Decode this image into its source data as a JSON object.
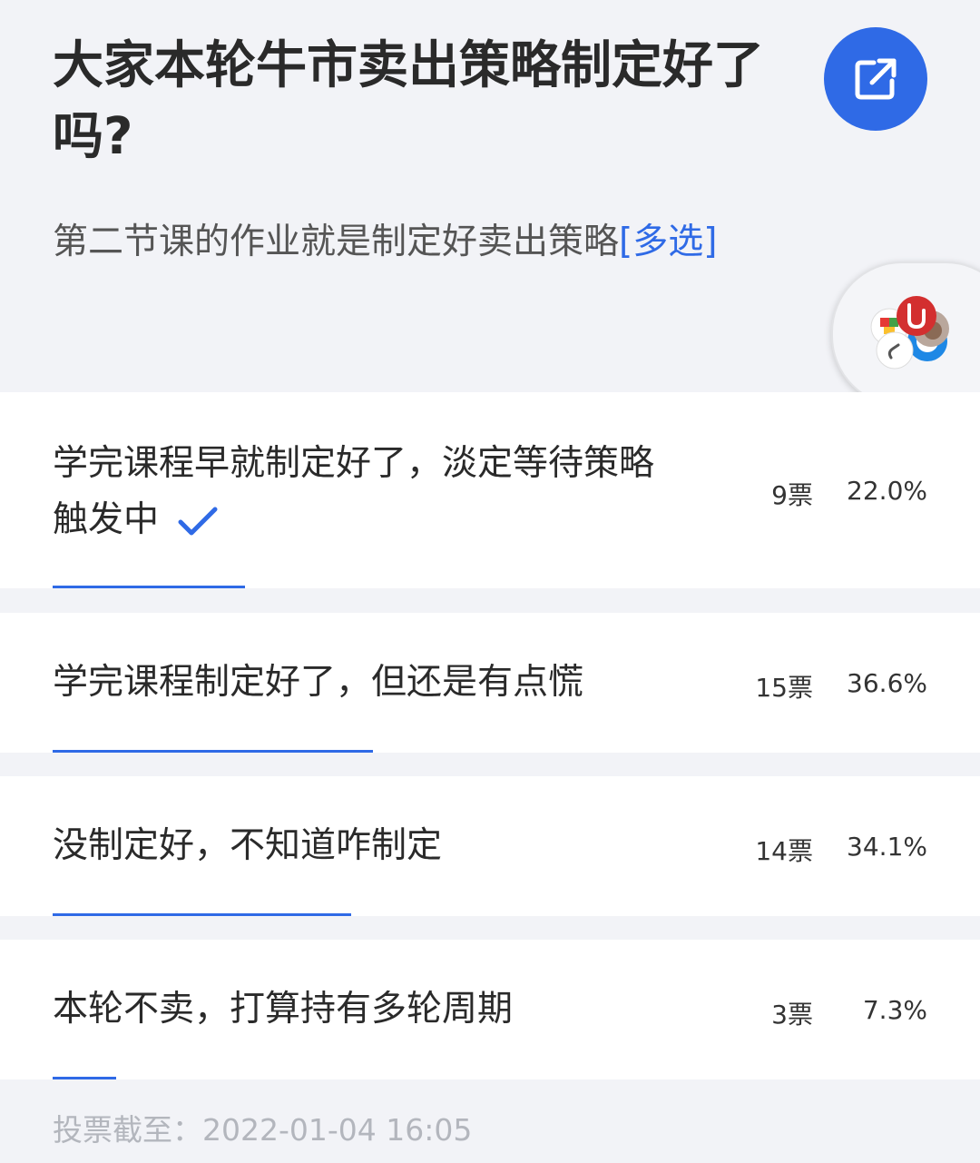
{
  "poll": {
    "title": "大家本轮牛市卖出策略制定好了吗?",
    "subtitle": "第二节课的作业就是制定好卖出策略",
    "multi_tag": "[多选]",
    "options": [
      {
        "label": "学完课程早就制定好了，淡定等待策略触发中",
        "votes": "9票",
        "percent": "22.0%",
        "percent_value": 22.0,
        "selected": true
      },
      {
        "label": "学完课程制定好了，但还是有点慌",
        "votes": "15票",
        "percent": "36.6%",
        "percent_value": 36.6,
        "selected": false
      },
      {
        "label": "没制定好，不知道咋制定",
        "votes": "14票",
        "percent": "34.1%",
        "percent_value": 34.1,
        "selected": false
      },
      {
        "label": "本轮不卖，打算持有多轮周期",
        "votes": "3票",
        "percent": "7.3%",
        "percent_value": 7.3,
        "selected": false
      }
    ],
    "deadline": "投票截至：2022-01-04 16:05"
  },
  "icons": {
    "share": "share-external-icon",
    "selected": "checkmark-icon",
    "floating": "floating-apps-icon"
  },
  "colors": {
    "accent": "#2f6ae6",
    "background": "#f2f3f7",
    "card": "#ffffff",
    "muted": "#b3b6bd"
  }
}
